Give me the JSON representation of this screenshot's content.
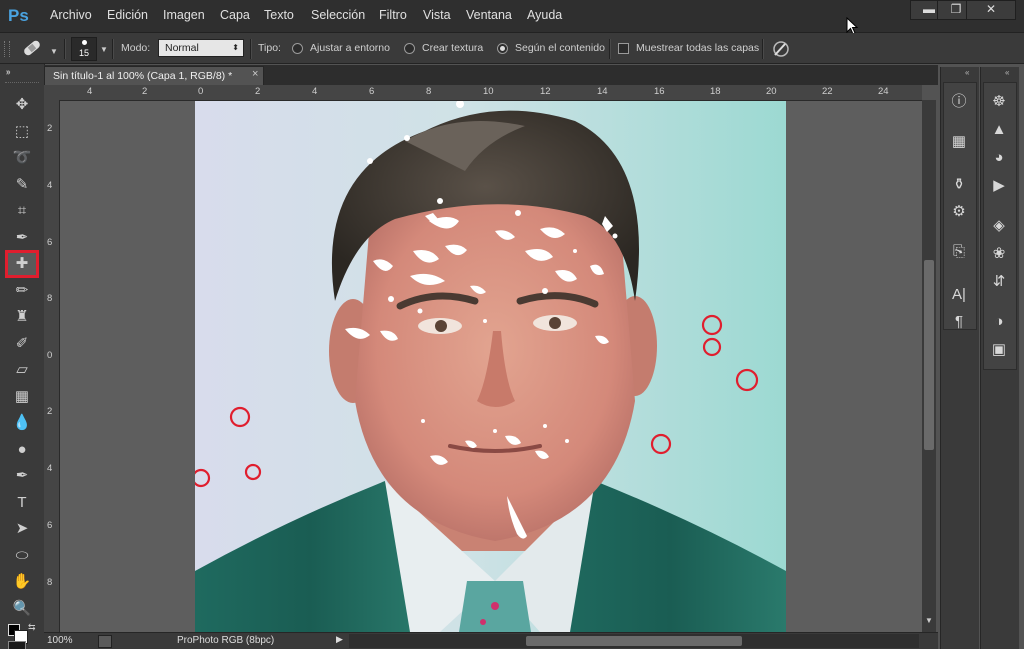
{
  "app": {
    "logo": "Ps"
  },
  "menu": [
    "Archivo",
    "Edición",
    "Imagen",
    "Capa",
    "Texto",
    "Selección",
    "Filtro",
    "Vista",
    "Ventana",
    "Ayuda"
  ],
  "window_controls": {
    "minimize": "▬",
    "maximize": "❐",
    "close": "✕"
  },
  "options": {
    "brush_size": "15",
    "mode_label": "Modo:",
    "mode_value": "Normal",
    "type_label": "Tipo:",
    "radio_1": "Ajustar a entorno",
    "radio_2": "Crear textura",
    "radio_3": "Según el contenido",
    "checkbox": "Muestrear todas las capas"
  },
  "document": {
    "tab_title": "Sin título-1 al 100% (Capa 1, RGB/8) *",
    "tab_close": "×"
  },
  "ruler_top": [
    "4",
    "2",
    "0",
    "2",
    "4",
    "6",
    "8",
    "10",
    "12",
    "14",
    "16",
    "18",
    "20",
    "22",
    "24"
  ],
  "ruler_left": [
    "2",
    "4",
    "6",
    "8",
    "0",
    "2",
    "4",
    "6",
    "8"
  ],
  "status": {
    "zoom": "100%",
    "profile": "ProPhoto RGB (8bpc)"
  },
  "tools": [
    {
      "name": "move-tool",
      "icon": "✥"
    },
    {
      "name": "marquee-tool",
      "icon": "⬚"
    },
    {
      "name": "lasso-tool",
      "icon": "➰"
    },
    {
      "name": "quick-selection-tool",
      "icon": "✎"
    },
    {
      "name": "crop-tool",
      "icon": "⌗"
    },
    {
      "name": "eyedropper-tool",
      "icon": "✒"
    },
    {
      "name": "spot-healing-brush-tool",
      "icon": "✚"
    },
    {
      "name": "brush-tool",
      "icon": "✏"
    },
    {
      "name": "clone-stamp-tool",
      "icon": "♜"
    },
    {
      "name": "history-brush-tool",
      "icon": "✐"
    },
    {
      "name": "eraser-tool",
      "icon": "▱"
    },
    {
      "name": "gradient-tool",
      "icon": "▦"
    },
    {
      "name": "blur-tool",
      "icon": "💧"
    },
    {
      "name": "dodge-tool",
      "icon": "●"
    },
    {
      "name": "pen-tool",
      "icon": "✒"
    },
    {
      "name": "type-tool",
      "icon": "T"
    },
    {
      "name": "path-selection-tool",
      "icon": "➤"
    },
    {
      "name": "ellipse-tool",
      "icon": "⬭"
    },
    {
      "name": "hand-tool",
      "icon": "✋"
    },
    {
      "name": "zoom-tool",
      "icon": "🔍"
    }
  ],
  "panel1_icons": [
    "info-icon",
    "navigator-icon",
    "brushes-icon",
    "tool-presets-icon",
    "clone-source-icon",
    "character-icon",
    "paragraph-icon"
  ],
  "panel2_icons": [
    "color-wheel-icon",
    "histogram-icon",
    "swatches-icon",
    "actions-icon",
    "layers-icon",
    "channels-icon",
    "paths-icon",
    "adjustments-icon",
    "styles-icon"
  ],
  "colors": {
    "accent_red": "#e01e2e",
    "ui_dark": "#3a3a3a",
    "canvas_bg": "#5e5e5e"
  }
}
